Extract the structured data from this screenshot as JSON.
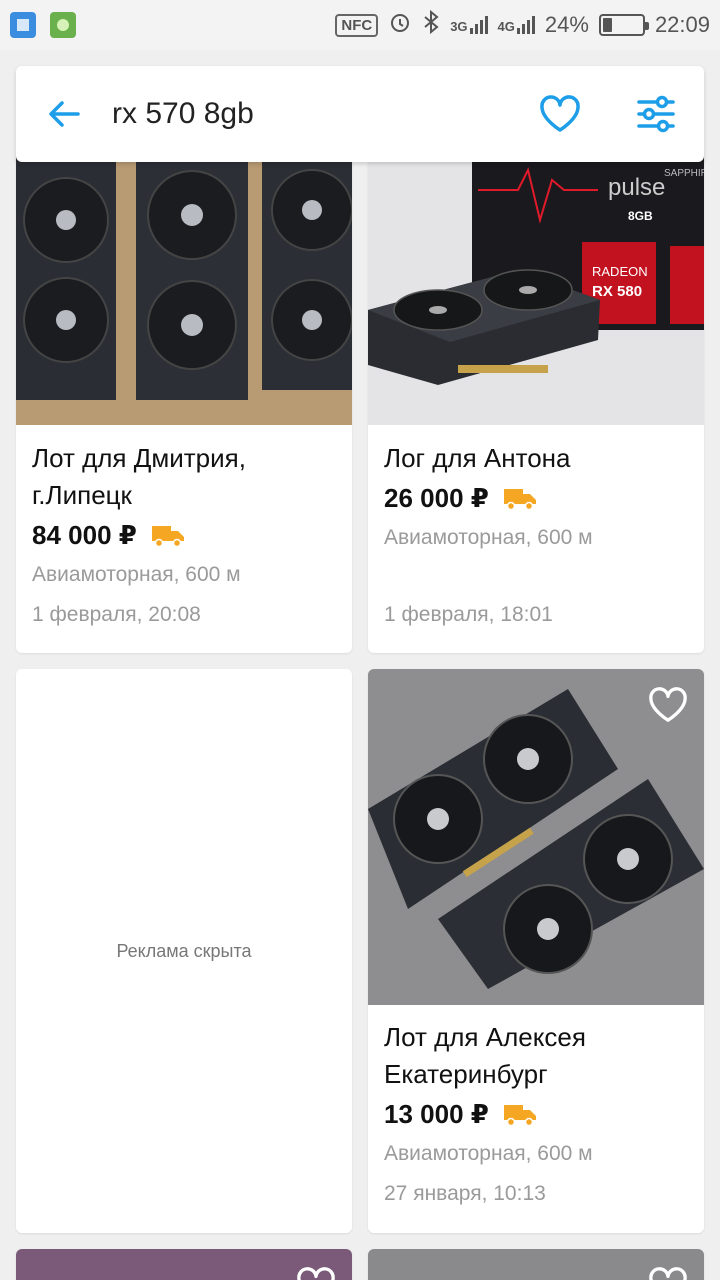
{
  "status_bar": {
    "nfc": "NFC",
    "net1": "3G",
    "net2": "4G",
    "battery": "24%",
    "battery_level": 0.24,
    "time": "22:09"
  },
  "header": {
    "query": "rx 570 8gb"
  },
  "listings": [
    {
      "title": "Лот для Дмитрия, г.Липецк",
      "price": "84 000 ₽",
      "location": "Авиамоторная,  600 м",
      "date": "1 февраля, 20:08"
    },
    {
      "title": "Лог для Антона",
      "price": "26 000 ₽",
      "location": "Авиамоторная,  600 м",
      "date": "1 февраля, 18:01",
      "box": {
        "brand": "pulse",
        "series": "RADEON",
        "model": "RX 580",
        "memory": "8GB",
        "maker": "SAPPHIRE"
      }
    },
    {
      "title": "Лот для Алексея Екатеринбург",
      "price": "13 000 ₽",
      "location": "Авиамоторная,  600 м",
      "date": "27 января, 10:13"
    }
  ],
  "ad": {
    "label": "Реклама скрыта"
  },
  "colors": {
    "accent": "#1e9ee8",
    "delivery": "#f5a623"
  }
}
